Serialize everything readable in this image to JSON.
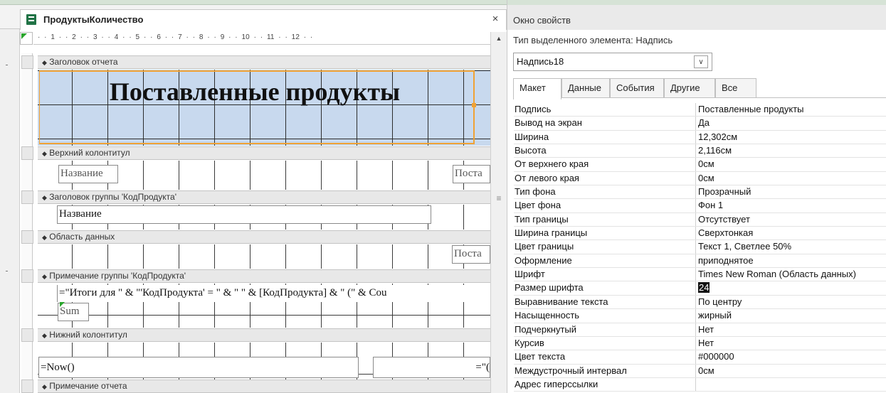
{
  "document": {
    "tab_title": "ПродуктыКоличество",
    "close_glyph": "×",
    "ruler_text": "·  ·  1  ·  ·  2  ·  ·  3  ·  ·  4  ·  ·  5  ·  ·  6  ·  ·  7  ·  ·  8  ·  ·  9  ·  ·  10  ·  ·  11  ·  ·  12  ·  ·"
  },
  "sections": {
    "report_header": "Заголовок отчета",
    "page_header": "Верхний колонтитул",
    "group_header": "Заголовок группы 'КодПродукта'",
    "detail": "Область данных",
    "group_footer": "Примечание группы 'КодПродукта'",
    "page_footer": "Нижний колонтитул",
    "report_footer": "Примечание отчета"
  },
  "controls": {
    "report_title": "Поставленные продукты",
    "page_header_name": "Название",
    "page_header_right": "Поста",
    "group_header_name": "Название",
    "detail_right": "Поста",
    "group_footer_expr": "=\"Итоги для \" & \"'КодПродукта' = \" & \" \" & [КодПродукта] & \" (\" & Cou",
    "group_footer_sum": "Sum",
    "page_footer_now": "=Now()",
    "page_footer_right": "=\"("
  },
  "property_sheet": {
    "title": "Окно свойств",
    "selection_label": "Тип выделенного элемента:  Надпись",
    "selected_object": "Надпись18",
    "tabs": [
      "Макет",
      "Данные",
      "События",
      "Другие",
      "Все"
    ],
    "active_tab": "Макет",
    "properties": [
      {
        "name": "Подпись",
        "value": "Поставленные продукты"
      },
      {
        "name": "Вывод на экран",
        "value": "Да"
      },
      {
        "name": "Ширина",
        "value": "12,302см"
      },
      {
        "name": "Высота",
        "value": "2,116см"
      },
      {
        "name": "От верхнего края",
        "value": "0см"
      },
      {
        "name": "От левого края",
        "value": "0см"
      },
      {
        "name": "Тип фона",
        "value": "Прозрачный"
      },
      {
        "name": "Цвет фона",
        "value": "Фон 1"
      },
      {
        "name": "Тип границы",
        "value": "Отсутствует"
      },
      {
        "name": "Ширина границы",
        "value": "Сверхтонкая"
      },
      {
        "name": "Цвет границы",
        "value": "Текст 1, Светлее 50%"
      },
      {
        "name": "Оформление",
        "value": "приподнятое"
      },
      {
        "name": "Шрифт",
        "value": "Times New Roman (Область данных)"
      },
      {
        "name": "Размер шрифта",
        "value": "24"
      },
      {
        "name": "Выравнивание текста",
        "value": "По центру"
      },
      {
        "name": "Насыщенность",
        "value": "жирный"
      },
      {
        "name": "Подчеркнутый",
        "value": "Нет"
      },
      {
        "name": "Курсив",
        "value": "Нет"
      },
      {
        "name": "Цвет текста",
        "value": "#000000"
      },
      {
        "name": "Междустрочный интервал",
        "value": "0см"
      },
      {
        "name": "Адрес гиперссылки",
        "value": ""
      }
    ]
  },
  "colors": {
    "title_band": "#c8d9ee",
    "selection_border": "#f0a235",
    "access_green": "#217346"
  },
  "icons": {
    "section_marker": "◆",
    "dropdown": "chevron-down-icon",
    "doc_icon": "report-icon",
    "scroll_up": "▲",
    "splitter": "≡"
  }
}
